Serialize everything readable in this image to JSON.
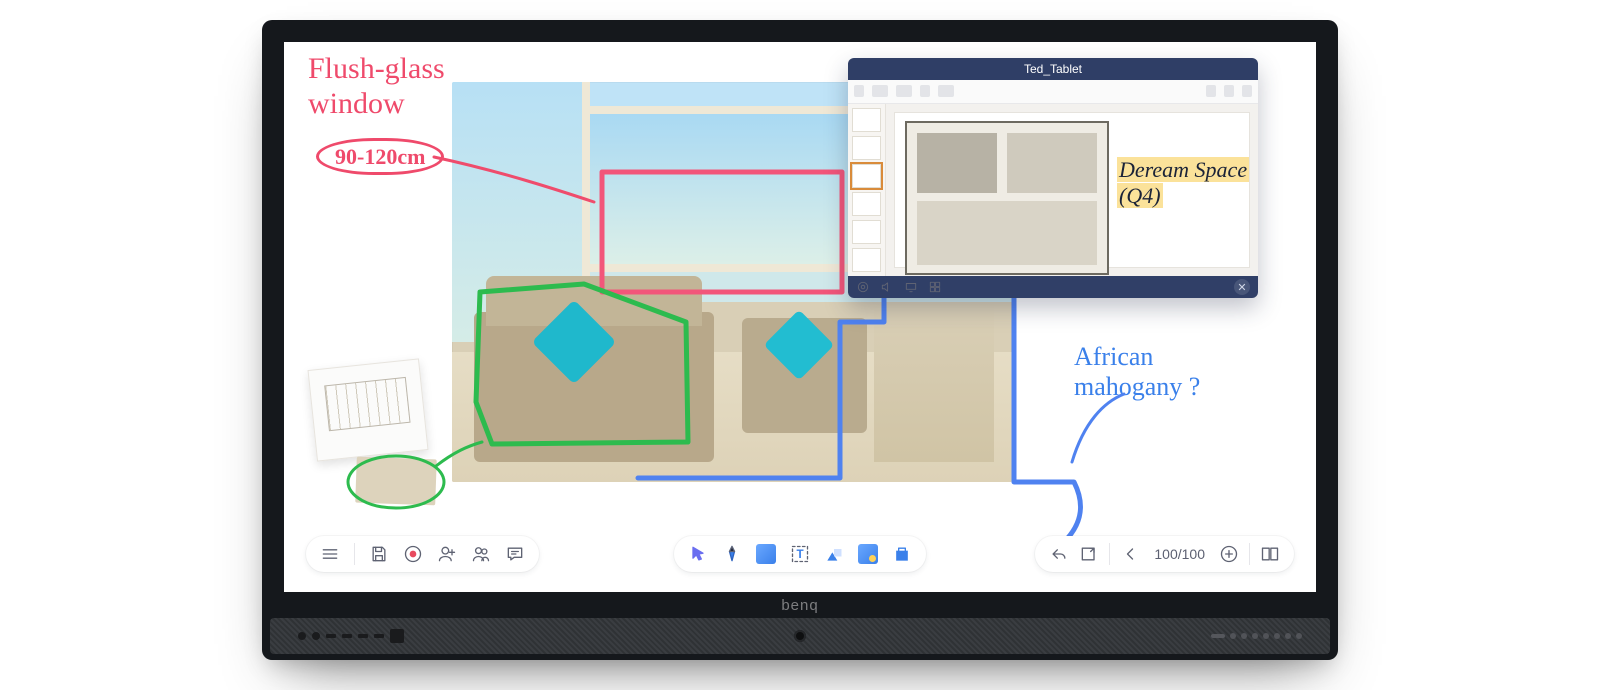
{
  "device": {
    "brand": "benq"
  },
  "annotations": {
    "title": "Flush-glass window",
    "dimension": "90-120cm",
    "floor_question": "African mahogany ?",
    "dream_space_line1": "Deream Space",
    "dream_space_line2": "(Q4)"
  },
  "sub_window": {
    "title": "Ted_Tablet",
    "bottom_icons": [
      "audio-icon",
      "volume-icon",
      "present-icon",
      "grid-icon"
    ],
    "close_glyph": "✕"
  },
  "toolbars": {
    "left": {
      "menu": "menu-icon",
      "save": "save-icon",
      "record": "record-icon",
      "add_user": "add-user-icon",
      "users": "users-icon",
      "comment": "comment-icon"
    },
    "center": {
      "select": "select-icon",
      "pen": "pen-icon",
      "shape_square": "square-icon",
      "text": "T",
      "shapes": "shapes-icon",
      "image": "image-icon",
      "app": "app-icon"
    },
    "right": {
      "undo": "undo-icon",
      "export": "export-icon",
      "prev": "prev-icon",
      "page_counter": "100/100",
      "add_page": "add-page-icon",
      "pages": "pages-icon"
    }
  }
}
